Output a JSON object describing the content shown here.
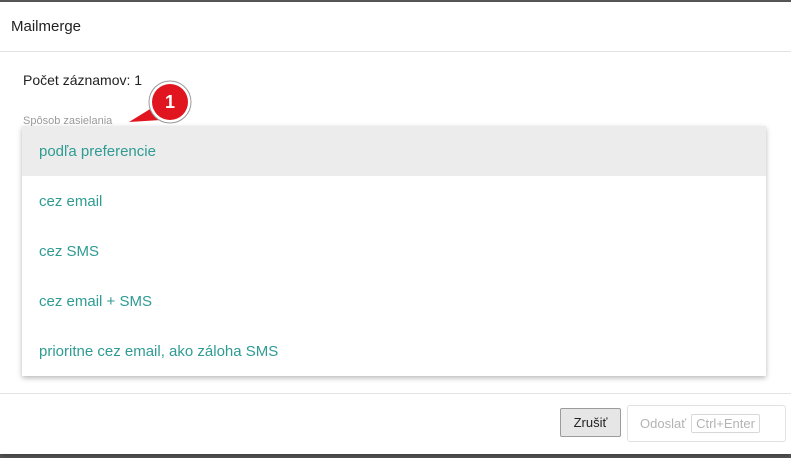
{
  "dialog": {
    "title": "Mailmerge",
    "record_count": "Počet záznamov: 1"
  },
  "field": {
    "label": "Spôsob zasielania",
    "options": [
      {
        "label": "podľa preferencie",
        "selected": true
      },
      {
        "label": "cez email",
        "selected": false
      },
      {
        "label": "cez SMS",
        "selected": false
      },
      {
        "label": "cez email + SMS",
        "selected": false
      },
      {
        "label": "prioritne cez email, ako záloha SMS",
        "selected": false
      }
    ]
  },
  "callout": {
    "number": "1",
    "color": "#e0151f"
  },
  "footer": {
    "cancel_label": "Zrušiť",
    "send_label": "Odoslať",
    "send_shortcut": "Ctrl+Enter"
  },
  "colors": {
    "option_text": "#2f9b93",
    "selected_bg": "#ececec"
  }
}
